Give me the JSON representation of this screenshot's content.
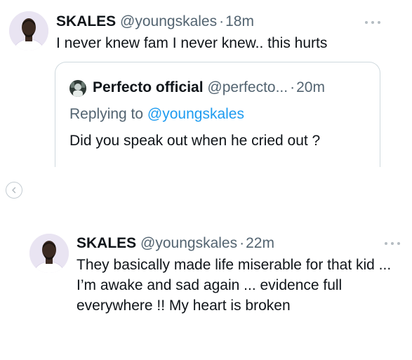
{
  "tweet1": {
    "name": "SKALES",
    "handle": "@youngskales",
    "separator": "·",
    "time": "18m",
    "text": "I never knew fam I never knew.. this hurts",
    "avatar_icon": "profile-avatar",
    "more_icon": "more-options-icon",
    "quote": {
      "name": "Perfecto official",
      "handle": "@perfecto...",
      "separator": "·",
      "time": "20m",
      "replying_prefix": "Replying to",
      "replying_handle": "@youngskales",
      "text": "Did you speak out when  he cried out ?",
      "avatar_icon": "profile-avatar"
    }
  },
  "tweet2": {
    "name": "SKALES",
    "handle": "@youngskales",
    "separator": "·",
    "time": "22m",
    "text": "They basically made life miserable for that kid ... I’m awake and sad again  ... evidence full everywhere !! My heart is broken",
    "avatar_icon": "profile-avatar",
    "more_icon": "more-options-icon"
  },
  "nav": {
    "back_icon": "chevron-left-icon"
  },
  "colors": {
    "text": "#0f1419",
    "secondary": "#536471",
    "link": "#1d9bf0",
    "border": "#cfd9de"
  }
}
